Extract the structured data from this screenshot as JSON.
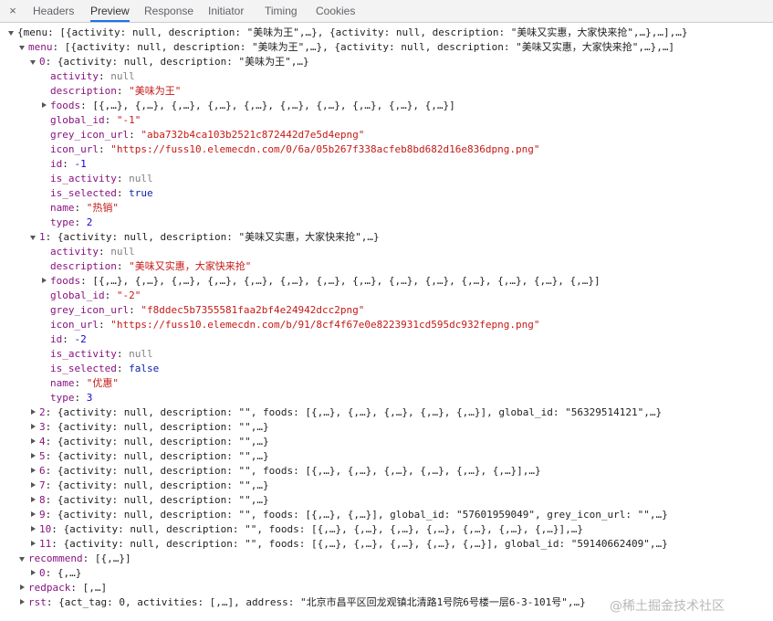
{
  "tabs": {
    "close": "×",
    "items": [
      "Headers",
      "Preview",
      "Response",
      "Initiator",
      "Timing",
      "Cookies"
    ],
    "active": "Preview"
  },
  "tree": [
    {
      "depth": 0,
      "arrow": "down",
      "parts": [
        [
          "t",
          "{menu: [{activity: null, description: \"美味为王\",…}, {activity: null, description: \"美味又实惠，大家快来抢\",…},…],…}"
        ]
      ]
    },
    {
      "depth": 1,
      "arrow": "down",
      "parts": [
        [
          "k",
          "menu"
        ],
        [
          "t",
          ": [{activity: null, description: \"美味为王\",…}, {activity: null, description: \"美味又实惠，大家快来抢\",…},…]"
        ]
      ]
    },
    {
      "depth": 2,
      "arrow": "down",
      "parts": [
        [
          "k",
          "0"
        ],
        [
          "t",
          ": {activity: null, description: \"美味为王\",…}"
        ]
      ]
    },
    {
      "depth": 3,
      "arrow": "",
      "parts": [
        [
          "k",
          "activity"
        ],
        [
          "t",
          ": "
        ],
        [
          "n",
          "null"
        ]
      ]
    },
    {
      "depth": 3,
      "arrow": "",
      "parts": [
        [
          "k",
          "description"
        ],
        [
          "t",
          ": "
        ],
        [
          "s",
          "\"美味为王\""
        ]
      ]
    },
    {
      "depth": 3,
      "arrow": "right",
      "parts": [
        [
          "k",
          "foods"
        ],
        [
          "t",
          ": [{,…}, {,…}, {,…}, {,…}, {,…}, {,…}, {,…}, {,…}, {,…}, {,…}]"
        ]
      ]
    },
    {
      "depth": 3,
      "arrow": "",
      "parts": [
        [
          "k",
          "global_id"
        ],
        [
          "t",
          ": "
        ],
        [
          "s",
          "\"-1\""
        ]
      ]
    },
    {
      "depth": 3,
      "arrow": "",
      "parts": [
        [
          "k",
          "grey_icon_url"
        ],
        [
          "t",
          ": "
        ],
        [
          "s",
          "\"aba732b4ca103b2521c872442d7e5d4epng\""
        ]
      ]
    },
    {
      "depth": 3,
      "arrow": "",
      "parts": [
        [
          "k",
          "icon_url"
        ],
        [
          "t",
          ": "
        ],
        [
          "s",
          "\"https://fuss10.elemecdn.com/0/6a/05b267f338acfeb8bd682d16e836dpng.png\""
        ]
      ]
    },
    {
      "depth": 3,
      "arrow": "",
      "parts": [
        [
          "k",
          "id"
        ],
        [
          "t",
          ": "
        ],
        [
          "d",
          "-1"
        ]
      ]
    },
    {
      "depth": 3,
      "arrow": "",
      "parts": [
        [
          "k",
          "is_activity"
        ],
        [
          "t",
          ": "
        ],
        [
          "n",
          "null"
        ]
      ]
    },
    {
      "depth": 3,
      "arrow": "",
      "parts": [
        [
          "k",
          "is_selected"
        ],
        [
          "t",
          ": "
        ],
        [
          "b",
          "true"
        ]
      ]
    },
    {
      "depth": 3,
      "arrow": "",
      "parts": [
        [
          "k",
          "name"
        ],
        [
          "t",
          ": "
        ],
        [
          "s",
          "\"热销\""
        ]
      ]
    },
    {
      "depth": 3,
      "arrow": "",
      "parts": [
        [
          "k",
          "type"
        ],
        [
          "t",
          ": "
        ],
        [
          "d",
          "2"
        ]
      ]
    },
    {
      "depth": 2,
      "arrow": "down",
      "parts": [
        [
          "k",
          "1"
        ],
        [
          "t",
          ": {activity: null, description: \"美味又实惠，大家快来抢\",…}"
        ]
      ]
    },
    {
      "depth": 3,
      "arrow": "",
      "parts": [
        [
          "k",
          "activity"
        ],
        [
          "t",
          ": "
        ],
        [
          "n",
          "null"
        ]
      ]
    },
    {
      "depth": 3,
      "arrow": "",
      "parts": [
        [
          "k",
          "description"
        ],
        [
          "t",
          ": "
        ],
        [
          "s",
          "\"美味又实惠，大家快来抢\""
        ]
      ]
    },
    {
      "depth": 3,
      "arrow": "right",
      "parts": [
        [
          "k",
          "foods"
        ],
        [
          "t",
          ": [{,…}, {,…}, {,…}, {,…}, {,…}, {,…}, {,…}, {,…}, {,…}, {,…}, {,…}, {,…}, {,…}, {,…}]"
        ]
      ]
    },
    {
      "depth": 3,
      "arrow": "",
      "parts": [
        [
          "k",
          "global_id"
        ],
        [
          "t",
          ": "
        ],
        [
          "s",
          "\"-2\""
        ]
      ]
    },
    {
      "depth": 3,
      "arrow": "",
      "parts": [
        [
          "k",
          "grey_icon_url"
        ],
        [
          "t",
          ": "
        ],
        [
          "s",
          "\"f8ddec5b7355581faa2bf4e24942dcc2png\""
        ]
      ]
    },
    {
      "depth": 3,
      "arrow": "",
      "parts": [
        [
          "k",
          "icon_url"
        ],
        [
          "t",
          ": "
        ],
        [
          "s",
          "\"https://fuss10.elemecdn.com/b/91/8cf4f67e0e8223931cd595dc932fepng.png\""
        ]
      ]
    },
    {
      "depth": 3,
      "arrow": "",
      "parts": [
        [
          "k",
          "id"
        ],
        [
          "t",
          ": "
        ],
        [
          "d",
          "-2"
        ]
      ]
    },
    {
      "depth": 3,
      "arrow": "",
      "parts": [
        [
          "k",
          "is_activity"
        ],
        [
          "t",
          ": "
        ],
        [
          "n",
          "null"
        ]
      ]
    },
    {
      "depth": 3,
      "arrow": "",
      "parts": [
        [
          "k",
          "is_selected"
        ],
        [
          "t",
          ": "
        ],
        [
          "b",
          "false"
        ]
      ]
    },
    {
      "depth": 3,
      "arrow": "",
      "parts": [
        [
          "k",
          "name"
        ],
        [
          "t",
          ": "
        ],
        [
          "s",
          "\"优惠\""
        ]
      ]
    },
    {
      "depth": 3,
      "arrow": "",
      "parts": [
        [
          "k",
          "type"
        ],
        [
          "t",
          ": "
        ],
        [
          "d",
          "3"
        ]
      ]
    },
    {
      "depth": 2,
      "arrow": "right",
      "parts": [
        [
          "k",
          "2"
        ],
        [
          "t",
          ": {activity: null, description: \"\", foods: [{,…}, {,…}, {,…}, {,…}, {,…}], global_id: \"56329514121\",…}"
        ]
      ]
    },
    {
      "depth": 2,
      "arrow": "right",
      "parts": [
        [
          "k",
          "3"
        ],
        [
          "t",
          ": {activity: null, description: \"\",…}"
        ]
      ]
    },
    {
      "depth": 2,
      "arrow": "right",
      "parts": [
        [
          "k",
          "4"
        ],
        [
          "t",
          ": {activity: null, description: \"\",…}"
        ]
      ]
    },
    {
      "depth": 2,
      "arrow": "right",
      "parts": [
        [
          "k",
          "5"
        ],
        [
          "t",
          ": {activity: null, description: \"\",…}"
        ]
      ]
    },
    {
      "depth": 2,
      "arrow": "right",
      "parts": [
        [
          "k",
          "6"
        ],
        [
          "t",
          ": {activity: null, description: \"\", foods: [{,…}, {,…}, {,…}, {,…}, {,…}, {,…}],…}"
        ]
      ]
    },
    {
      "depth": 2,
      "arrow": "right",
      "parts": [
        [
          "k",
          "7"
        ],
        [
          "t",
          ": {activity: null, description: \"\",…}"
        ]
      ]
    },
    {
      "depth": 2,
      "arrow": "right",
      "parts": [
        [
          "k",
          "8"
        ],
        [
          "t",
          ": {activity: null, description: \"\",…}"
        ]
      ]
    },
    {
      "depth": 2,
      "arrow": "right",
      "parts": [
        [
          "k",
          "9"
        ],
        [
          "t",
          ": {activity: null, description: \"\", foods: [{,…}, {,…}], global_id: \"57601959049\", grey_icon_url: \"\",…}"
        ]
      ]
    },
    {
      "depth": 2,
      "arrow": "right",
      "parts": [
        [
          "k",
          "10"
        ],
        [
          "t",
          ": {activity: null, description: \"\", foods: [{,…}, {,…}, {,…}, {,…}, {,…}, {,…}, {,…}],…}"
        ]
      ]
    },
    {
      "depth": 2,
      "arrow": "right",
      "parts": [
        [
          "k",
          "11"
        ],
        [
          "t",
          ": {activity: null, description: \"\", foods: [{,…}, {,…}, {,…}, {,…}, {,…}], global_id: \"59140662409\",…}"
        ]
      ]
    },
    {
      "depth": 1,
      "arrow": "down",
      "parts": [
        [
          "k",
          "recommend"
        ],
        [
          "t",
          ": [{,…}]"
        ]
      ]
    },
    {
      "depth": 2,
      "arrow": "right",
      "parts": [
        [
          "k",
          "0"
        ],
        [
          "t",
          ": {,…}"
        ]
      ]
    },
    {
      "depth": 1,
      "arrow": "right",
      "parts": [
        [
          "k",
          "redpack"
        ],
        [
          "t",
          ": [,…]"
        ]
      ]
    },
    {
      "depth": 1,
      "arrow": "right",
      "parts": [
        [
          "k",
          "rst"
        ],
        [
          "t",
          ": {act_tag: 0, activities: [,…], address: \"北京市昌平区回龙观镇北清路1号院6号楼一层6-3-101号\",…}"
        ]
      ]
    }
  ],
  "watermark": "@稀土掘金技术社区"
}
